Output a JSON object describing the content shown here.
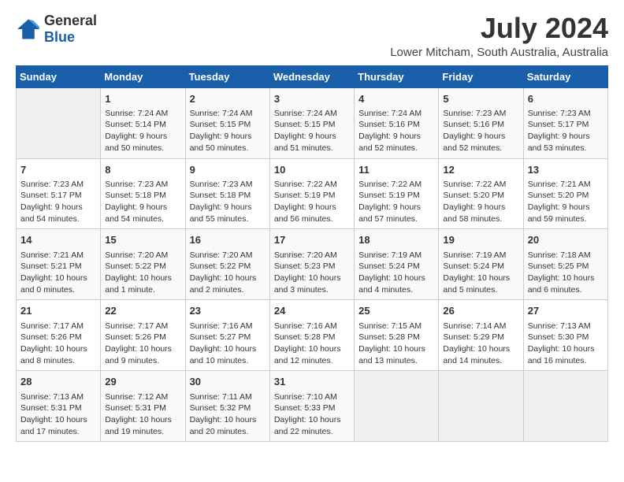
{
  "logo": {
    "general": "General",
    "blue": "Blue"
  },
  "header": {
    "month_year": "July 2024",
    "location": "Lower Mitcham, South Australia, Australia"
  },
  "days_of_week": [
    "Sunday",
    "Monday",
    "Tuesday",
    "Wednesday",
    "Thursday",
    "Friday",
    "Saturday"
  ],
  "weeks": [
    [
      {
        "day": "",
        "text": ""
      },
      {
        "day": "1",
        "text": "Sunrise: 7:24 AM\nSunset: 5:14 PM\nDaylight: 9 hours\nand 50 minutes."
      },
      {
        "day": "2",
        "text": "Sunrise: 7:24 AM\nSunset: 5:15 PM\nDaylight: 9 hours\nand 50 minutes."
      },
      {
        "day": "3",
        "text": "Sunrise: 7:24 AM\nSunset: 5:15 PM\nDaylight: 9 hours\nand 51 minutes."
      },
      {
        "day": "4",
        "text": "Sunrise: 7:24 AM\nSunset: 5:16 PM\nDaylight: 9 hours\nand 52 minutes."
      },
      {
        "day": "5",
        "text": "Sunrise: 7:23 AM\nSunset: 5:16 PM\nDaylight: 9 hours\nand 52 minutes."
      },
      {
        "day": "6",
        "text": "Sunrise: 7:23 AM\nSunset: 5:17 PM\nDaylight: 9 hours\nand 53 minutes."
      }
    ],
    [
      {
        "day": "7",
        "text": "Sunrise: 7:23 AM\nSunset: 5:17 PM\nDaylight: 9 hours\nand 54 minutes."
      },
      {
        "day": "8",
        "text": "Sunrise: 7:23 AM\nSunset: 5:18 PM\nDaylight: 9 hours\nand 54 minutes."
      },
      {
        "day": "9",
        "text": "Sunrise: 7:23 AM\nSunset: 5:18 PM\nDaylight: 9 hours\nand 55 minutes."
      },
      {
        "day": "10",
        "text": "Sunrise: 7:22 AM\nSunset: 5:19 PM\nDaylight: 9 hours\nand 56 minutes."
      },
      {
        "day": "11",
        "text": "Sunrise: 7:22 AM\nSunset: 5:19 PM\nDaylight: 9 hours\nand 57 minutes."
      },
      {
        "day": "12",
        "text": "Sunrise: 7:22 AM\nSunset: 5:20 PM\nDaylight: 9 hours\nand 58 minutes."
      },
      {
        "day": "13",
        "text": "Sunrise: 7:21 AM\nSunset: 5:20 PM\nDaylight: 9 hours\nand 59 minutes."
      }
    ],
    [
      {
        "day": "14",
        "text": "Sunrise: 7:21 AM\nSunset: 5:21 PM\nDaylight: 10 hours\nand 0 minutes."
      },
      {
        "day": "15",
        "text": "Sunrise: 7:20 AM\nSunset: 5:22 PM\nDaylight: 10 hours\nand 1 minute."
      },
      {
        "day": "16",
        "text": "Sunrise: 7:20 AM\nSunset: 5:22 PM\nDaylight: 10 hours\nand 2 minutes."
      },
      {
        "day": "17",
        "text": "Sunrise: 7:20 AM\nSunset: 5:23 PM\nDaylight: 10 hours\nand 3 minutes."
      },
      {
        "day": "18",
        "text": "Sunrise: 7:19 AM\nSunset: 5:24 PM\nDaylight: 10 hours\nand 4 minutes."
      },
      {
        "day": "19",
        "text": "Sunrise: 7:19 AM\nSunset: 5:24 PM\nDaylight: 10 hours\nand 5 minutes."
      },
      {
        "day": "20",
        "text": "Sunrise: 7:18 AM\nSunset: 5:25 PM\nDaylight: 10 hours\nand 6 minutes."
      }
    ],
    [
      {
        "day": "21",
        "text": "Sunrise: 7:17 AM\nSunset: 5:26 PM\nDaylight: 10 hours\nand 8 minutes."
      },
      {
        "day": "22",
        "text": "Sunrise: 7:17 AM\nSunset: 5:26 PM\nDaylight: 10 hours\nand 9 minutes."
      },
      {
        "day": "23",
        "text": "Sunrise: 7:16 AM\nSunset: 5:27 PM\nDaylight: 10 hours\nand 10 minutes."
      },
      {
        "day": "24",
        "text": "Sunrise: 7:16 AM\nSunset: 5:28 PM\nDaylight: 10 hours\nand 12 minutes."
      },
      {
        "day": "25",
        "text": "Sunrise: 7:15 AM\nSunset: 5:28 PM\nDaylight: 10 hours\nand 13 minutes."
      },
      {
        "day": "26",
        "text": "Sunrise: 7:14 AM\nSunset: 5:29 PM\nDaylight: 10 hours\nand 14 minutes."
      },
      {
        "day": "27",
        "text": "Sunrise: 7:13 AM\nSunset: 5:30 PM\nDaylight: 10 hours\nand 16 minutes."
      }
    ],
    [
      {
        "day": "28",
        "text": "Sunrise: 7:13 AM\nSunset: 5:31 PM\nDaylight: 10 hours\nand 17 minutes."
      },
      {
        "day": "29",
        "text": "Sunrise: 7:12 AM\nSunset: 5:31 PM\nDaylight: 10 hours\nand 19 minutes."
      },
      {
        "day": "30",
        "text": "Sunrise: 7:11 AM\nSunset: 5:32 PM\nDaylight: 10 hours\nand 20 minutes."
      },
      {
        "day": "31",
        "text": "Sunrise: 7:10 AM\nSunset: 5:33 PM\nDaylight: 10 hours\nand 22 minutes."
      },
      {
        "day": "",
        "text": ""
      },
      {
        "day": "",
        "text": ""
      },
      {
        "day": "",
        "text": ""
      }
    ]
  ]
}
